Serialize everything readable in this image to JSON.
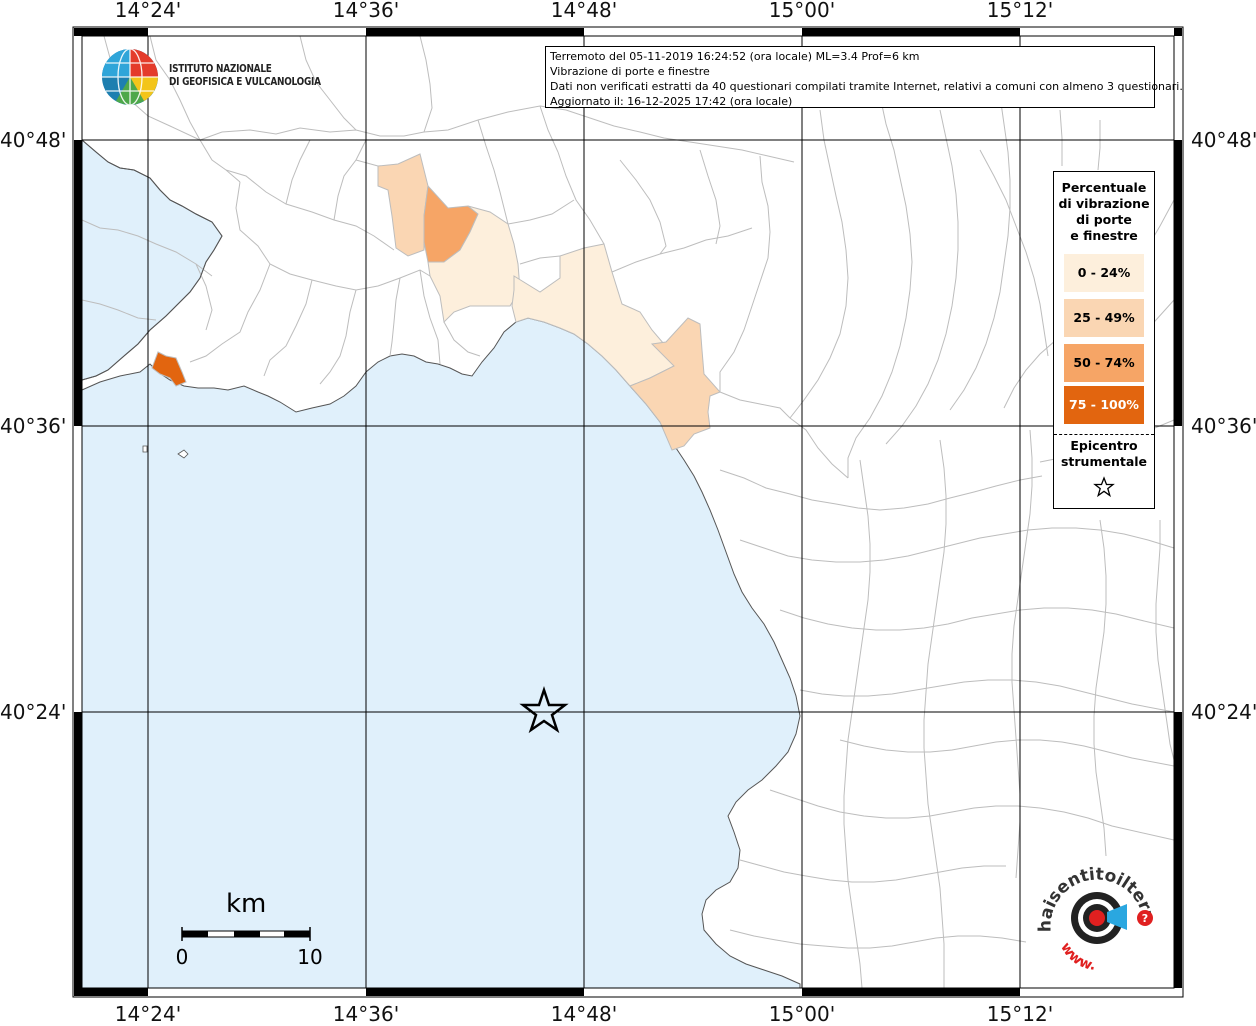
{
  "axes": {
    "lon_labels": [
      "14°24'",
      "14°36'",
      "14°48'",
      "15°00'",
      "15°12'"
    ],
    "lat_labels": [
      "40°48'",
      "40°36'",
      "40°24'"
    ]
  },
  "info": {
    "line1": "Terremoto del 05-11-2019 16:24:52 (ora locale) ML=3.4 Prof=6 km",
    "line2": "Vibrazione di porte e finestre",
    "line3": "Dati non verificati estratti da 40 questionari compilati tramite Internet, relativi a comuni con almeno 3 questionari.",
    "line4": "Aggiornato il: 16-12-2025 17:42 (ora locale)"
  },
  "legend": {
    "title_l1": "Percentuale",
    "title_l2": "di vibrazione",
    "title_l3": "di porte",
    "title_l4": "e finestre",
    "classes": [
      {
        "label": "0 - 24%",
        "color": "#fdefdc"
      },
      {
        "label": "25 - 49%",
        "color": "#fad6b3"
      },
      {
        "label": "50 - 74%",
        "color": "#f6a566"
      },
      {
        "label": "75 - 100%",
        "color": "#e2650f"
      }
    ],
    "epi_l1": "Epicentro",
    "epi_l2": "strumentale"
  },
  "logo": {
    "line1": "ISTITUTO NAZIONALE",
    "line2": "DI GEOFISICA E VULCANOLOGIA"
  },
  "scalebar": {
    "unit": "km",
    "start": "0",
    "end": "10"
  },
  "hst_logo": {
    "text": "haisentitoilterremoto.it",
    "www": "www."
  },
  "colors": {
    "sea": "#e0f0fb",
    "land": "#ffffff",
    "grid": "#000000",
    "border": "#bdbdbd"
  }
}
